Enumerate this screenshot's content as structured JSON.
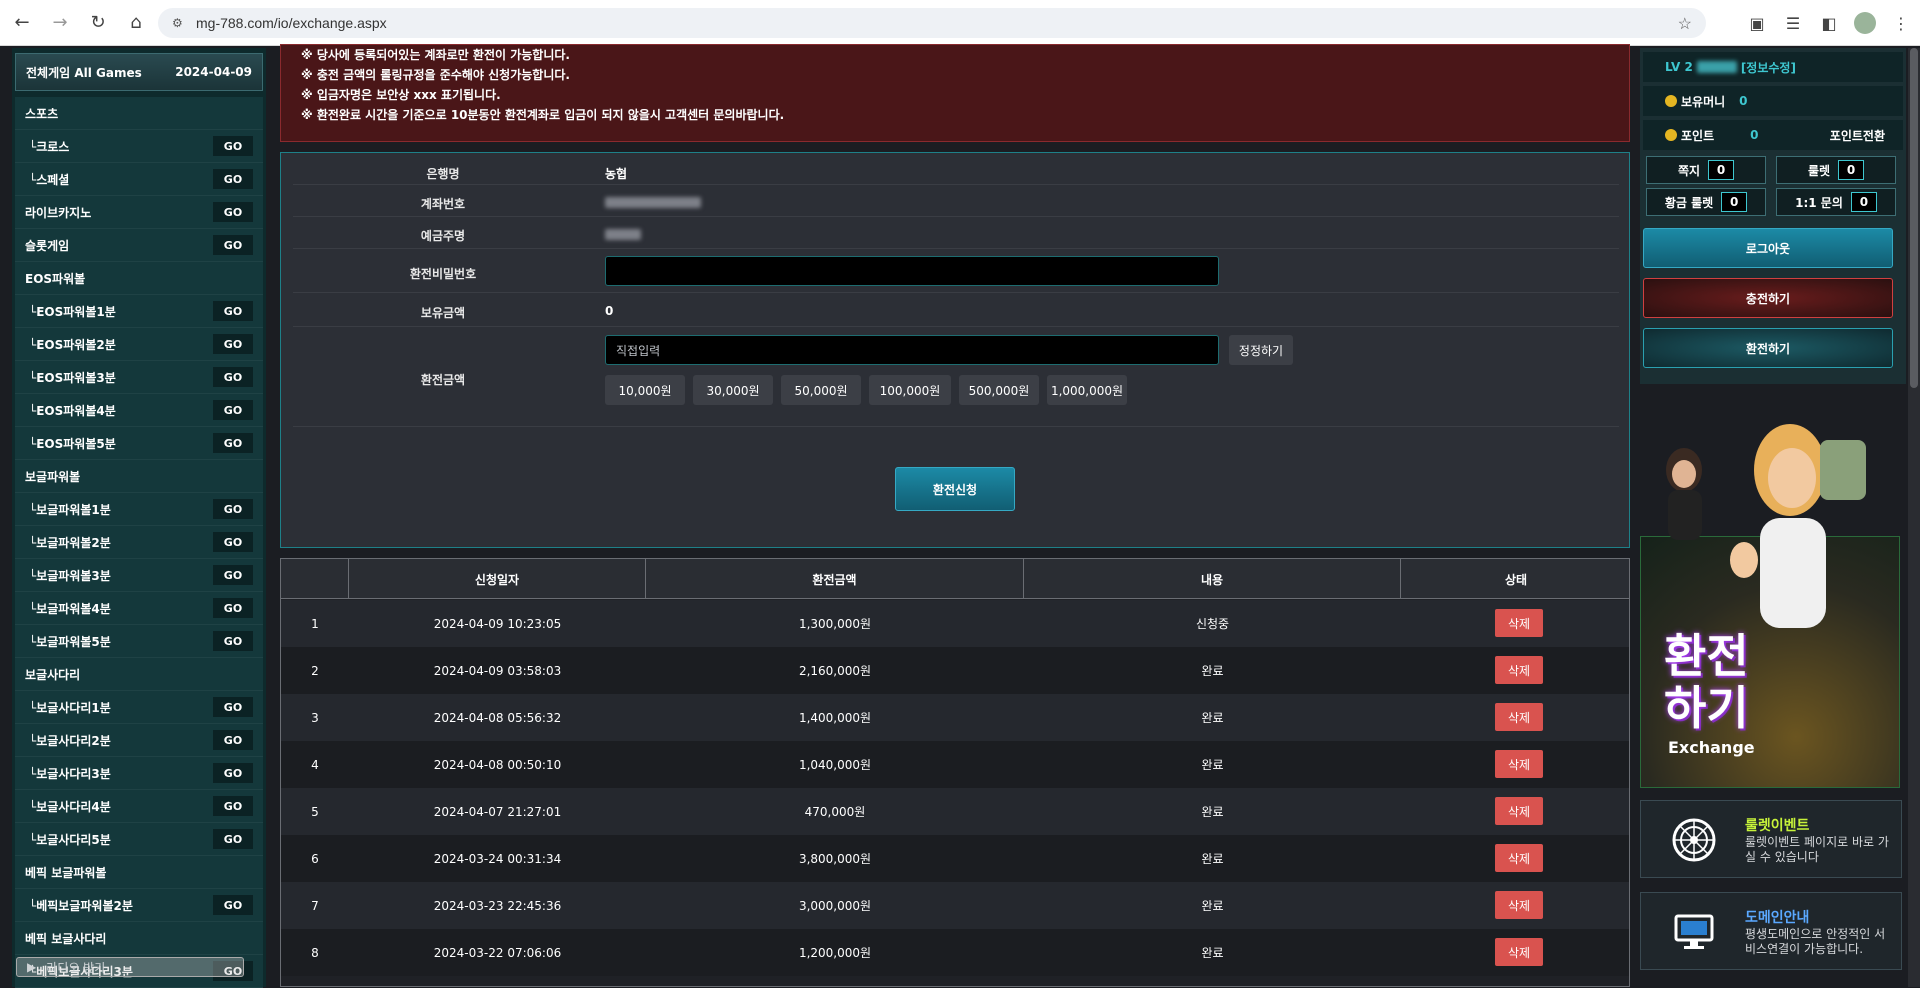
{
  "browser": {
    "url": "mg-788.com/io/exchange.aspx"
  },
  "sidebar": {
    "header_left": "전체게임 All Games",
    "header_right": "2024-04-09",
    "go_label": "GO",
    "items": [
      {
        "label": "스포츠",
        "go": false
      },
      {
        "label": "└크로스",
        "go": true
      },
      {
        "label": "└스페셜",
        "go": true
      },
      {
        "label": "라이브카지노",
        "go": true
      },
      {
        "label": "슬롯게임",
        "go": true
      },
      {
        "label": "EOS파워볼",
        "go": false
      },
      {
        "label": "└EOS파워볼1분",
        "go": true
      },
      {
        "label": "└EOS파워볼2분",
        "go": true
      },
      {
        "label": "└EOS파워볼3분",
        "go": true
      },
      {
        "label": "└EOS파워볼4분",
        "go": true
      },
      {
        "label": "└EOS파워볼5분",
        "go": true
      },
      {
        "label": "보글파워볼",
        "go": false
      },
      {
        "label": "└보글파워볼1분",
        "go": true
      },
      {
        "label": "└보글파워볼2분",
        "go": true
      },
      {
        "label": "└보글파워볼3분",
        "go": true
      },
      {
        "label": "└보글파워볼4분",
        "go": true
      },
      {
        "label": "└보글파워볼5분",
        "go": true
      },
      {
        "label": "보글사다리",
        "go": false
      },
      {
        "label": "└보글사다리1분",
        "go": true
      },
      {
        "label": "└보글사다리2분",
        "go": true
      },
      {
        "label": "└보글사다리3분",
        "go": true
      },
      {
        "label": "└보글사다리4분",
        "go": true
      },
      {
        "label": "└보글사다리5분",
        "go": true
      },
      {
        "label": "베픽 보글파워볼",
        "go": false
      },
      {
        "label": "└베픽보글파워볼2분",
        "go": true
      },
      {
        "label": "베픽 보글사다리",
        "go": false
      },
      {
        "label": "└베픽보글사다리3분",
        "go": true
      }
    ],
    "radio_text": "라디오 받기"
  },
  "notice": {
    "lines": [
      "※ 당사에 등록되어있는 계좌로만 환전이 가능합니다.",
      "※ 충전 금액의 롤링규정을 준수해야 신청가능합니다.",
      "※ 입금자명은 보안상 xxx 표기됩니다.",
      "※ 환전완료 시간을 기준으로 10분동안 환전계좌로 입금이 되지 않을시 고객센터 문의바랍니다."
    ]
  },
  "form": {
    "bank_label": "은행명",
    "bank_value": "농협",
    "account_label": "계좌번호",
    "holder_label": "예금주명",
    "password_label": "환전비밀번호",
    "balance_label": "보유금액",
    "balance_value": "0",
    "amount_label": "환전금액",
    "amount_placeholder": "직접입력",
    "reset_label": "정정하기",
    "amounts": [
      "10,000원",
      "30,000원",
      "50,000원",
      "100,000원",
      "500,000원",
      "1,000,000원"
    ],
    "submit_label": "환전신청"
  },
  "table": {
    "headers": [
      "신청일자",
      "환전금액",
      "내용",
      "상태"
    ],
    "delete_label": "삭제",
    "rows": [
      {
        "no": "1",
        "date": "2024-04-09 10:23:05",
        "amount": "1,300,000원",
        "status": "신청중"
      },
      {
        "no": "2",
        "date": "2024-04-09 03:58:03",
        "amount": "2,160,000원",
        "status": "완료"
      },
      {
        "no": "3",
        "date": "2024-04-08 05:56:32",
        "amount": "1,400,000원",
        "status": "완료"
      },
      {
        "no": "4",
        "date": "2024-04-08 00:50:10",
        "amount": "1,040,000원",
        "status": "완료"
      },
      {
        "no": "5",
        "date": "2024-04-07 21:27:01",
        "amount": "470,000원",
        "status": "완료"
      },
      {
        "no": "6",
        "date": "2024-03-24 00:31:34",
        "amount": "3,800,000원",
        "status": "완료"
      },
      {
        "no": "7",
        "date": "2024-03-23 22:45:36",
        "amount": "3,000,000원",
        "status": "완료"
      },
      {
        "no": "8",
        "date": "2024-03-22 07:06:06",
        "amount": "1,200,000원",
        "status": "완료"
      }
    ]
  },
  "user": {
    "level": "LV 2",
    "edit_label": "[정보수정]",
    "money_label": "보유머니",
    "money_value": "0",
    "point_label": "포인트",
    "point_value": "0",
    "point_convert": "포인트전환",
    "note_label": "쪽지",
    "note_count": "0",
    "roulette_label": "룰렛",
    "roulette_count": "0",
    "gold_roulette_label": "황금 룰렛",
    "gold_roulette_count": "0",
    "inquiry_label": "1:1 문의",
    "inquiry_count": "0",
    "logout_label": "로그아웃",
    "charge_label": "충전하기",
    "exchange_label": "환전하기"
  },
  "banner": {
    "title_line1": "환전",
    "title_line2": "하기",
    "subtitle": "Exchange"
  },
  "cards": [
    {
      "title": "룰렛이벤트",
      "desc": "룰렛이벤트 페이지로 바로 가실 수 있습니다"
    },
    {
      "title": "도메인안내",
      "desc": "평생도메인으로 안정적인 서비스연결이 가능합니다."
    }
  ],
  "colors": {
    "accent": "#1c8aa6",
    "danger": "#d9534f",
    "notice_bg": "#4a1618",
    "card_title": "#c6f23a"
  }
}
